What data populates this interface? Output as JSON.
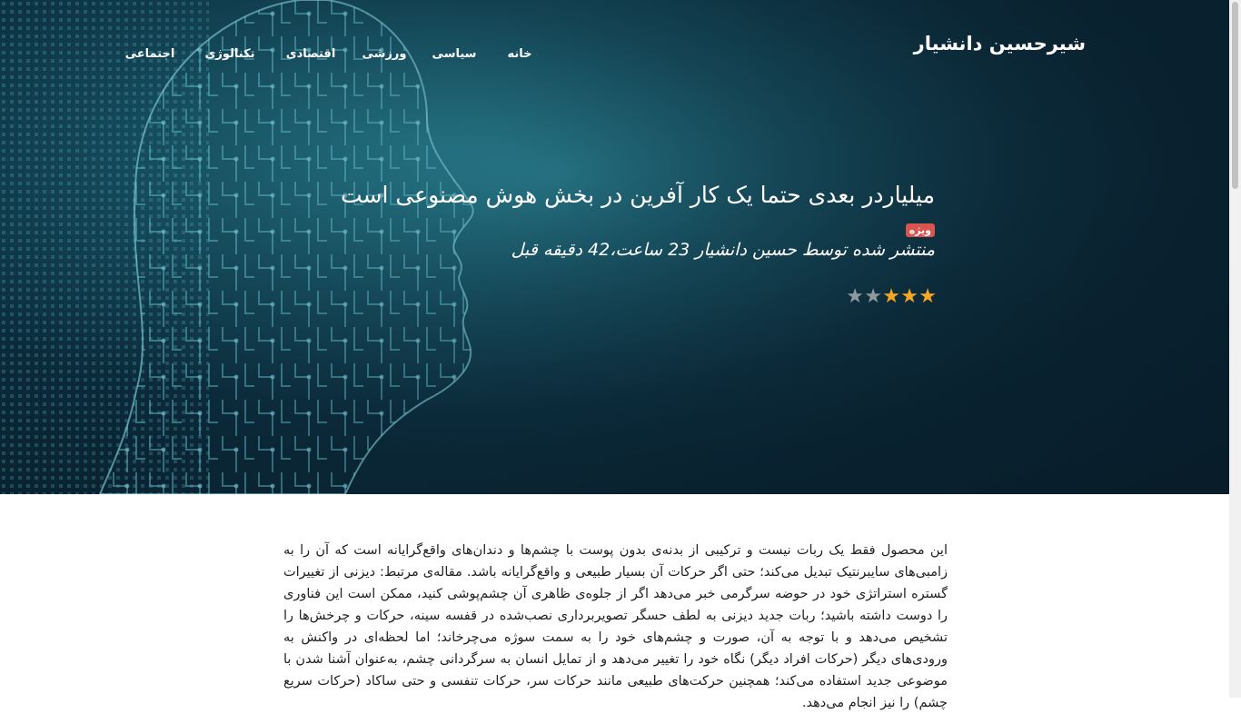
{
  "site": {
    "brand": "شیرحسین دانشیار"
  },
  "nav": {
    "items": [
      {
        "label": "خانه"
      },
      {
        "label": "سیاسی"
      },
      {
        "label": "ورزشی"
      },
      {
        "label": "اقتصادی"
      },
      {
        "label": "تکنالوژی"
      },
      {
        "label": "اجتماعی"
      }
    ]
  },
  "hero": {
    "title": "میلیاردر بعدی حتما یک کار آفرین در بخش هوش مصنوعی است",
    "badge": "ویژه",
    "meta": "منتشر شده توسط حسین دانشیار 23 ساعت،42 دقیقه قبل",
    "rating": {
      "value": 3,
      "max": 5,
      "icon": "star-icon",
      "filled_color": "#f5a623",
      "empty_color": "#8f9aa0"
    }
  },
  "article": {
    "body": "این محصول فقط یک ربات نیست و ترکیبی از بدنه‌ی بدون پوست با چشم‌ها و دندان‌های واقع‌گرایانه است که آن را به زامبی‌های سایبرنتیک تبدیل می‌کند؛ حتی اگر حرکات آن بسیار طبیعی و واقع‌گرایانه باشد. مقاله‌ی مرتبط: دیزنی از تغییرات گستره استراتژی خود در حوضه سرگرمی خبر می‌دهد اگر از جلوه‌ی ظاهری آن چشم‌پوشی کنید، ممکن است این فناوری را دوست داشته باشید؛ ربات جدید دیزنی به لطف حسگر تصویربرداری نصب‌شده در قفسه سینه، حرکات و چرخش‌ها را تشخیص می‌دهد و با توجه به آن، صورت و چشم‌های خود را به سمت سوژه می‌چرخاند؛ اما لحظه‌ای در واکنش به ورودی‌های دیگر (حرکات افراد دیگر) نگاه خود را تغییر می‌دهد و از تمایل انسان به سرگردانی چشم، به‌عنوان آشنا شدن با موضوعی جدید استفاده می‌کند؛ همچنین حرکت‌های طبیعی مانند حرکات سر، حرکات تنفسی و حتی ساکاد (حرکات سریع چشم) را نیز انجام می‌دهد."
  },
  "theme": {
    "badge_color": "#d9534f",
    "hero_bg": "#0b2a3a"
  }
}
